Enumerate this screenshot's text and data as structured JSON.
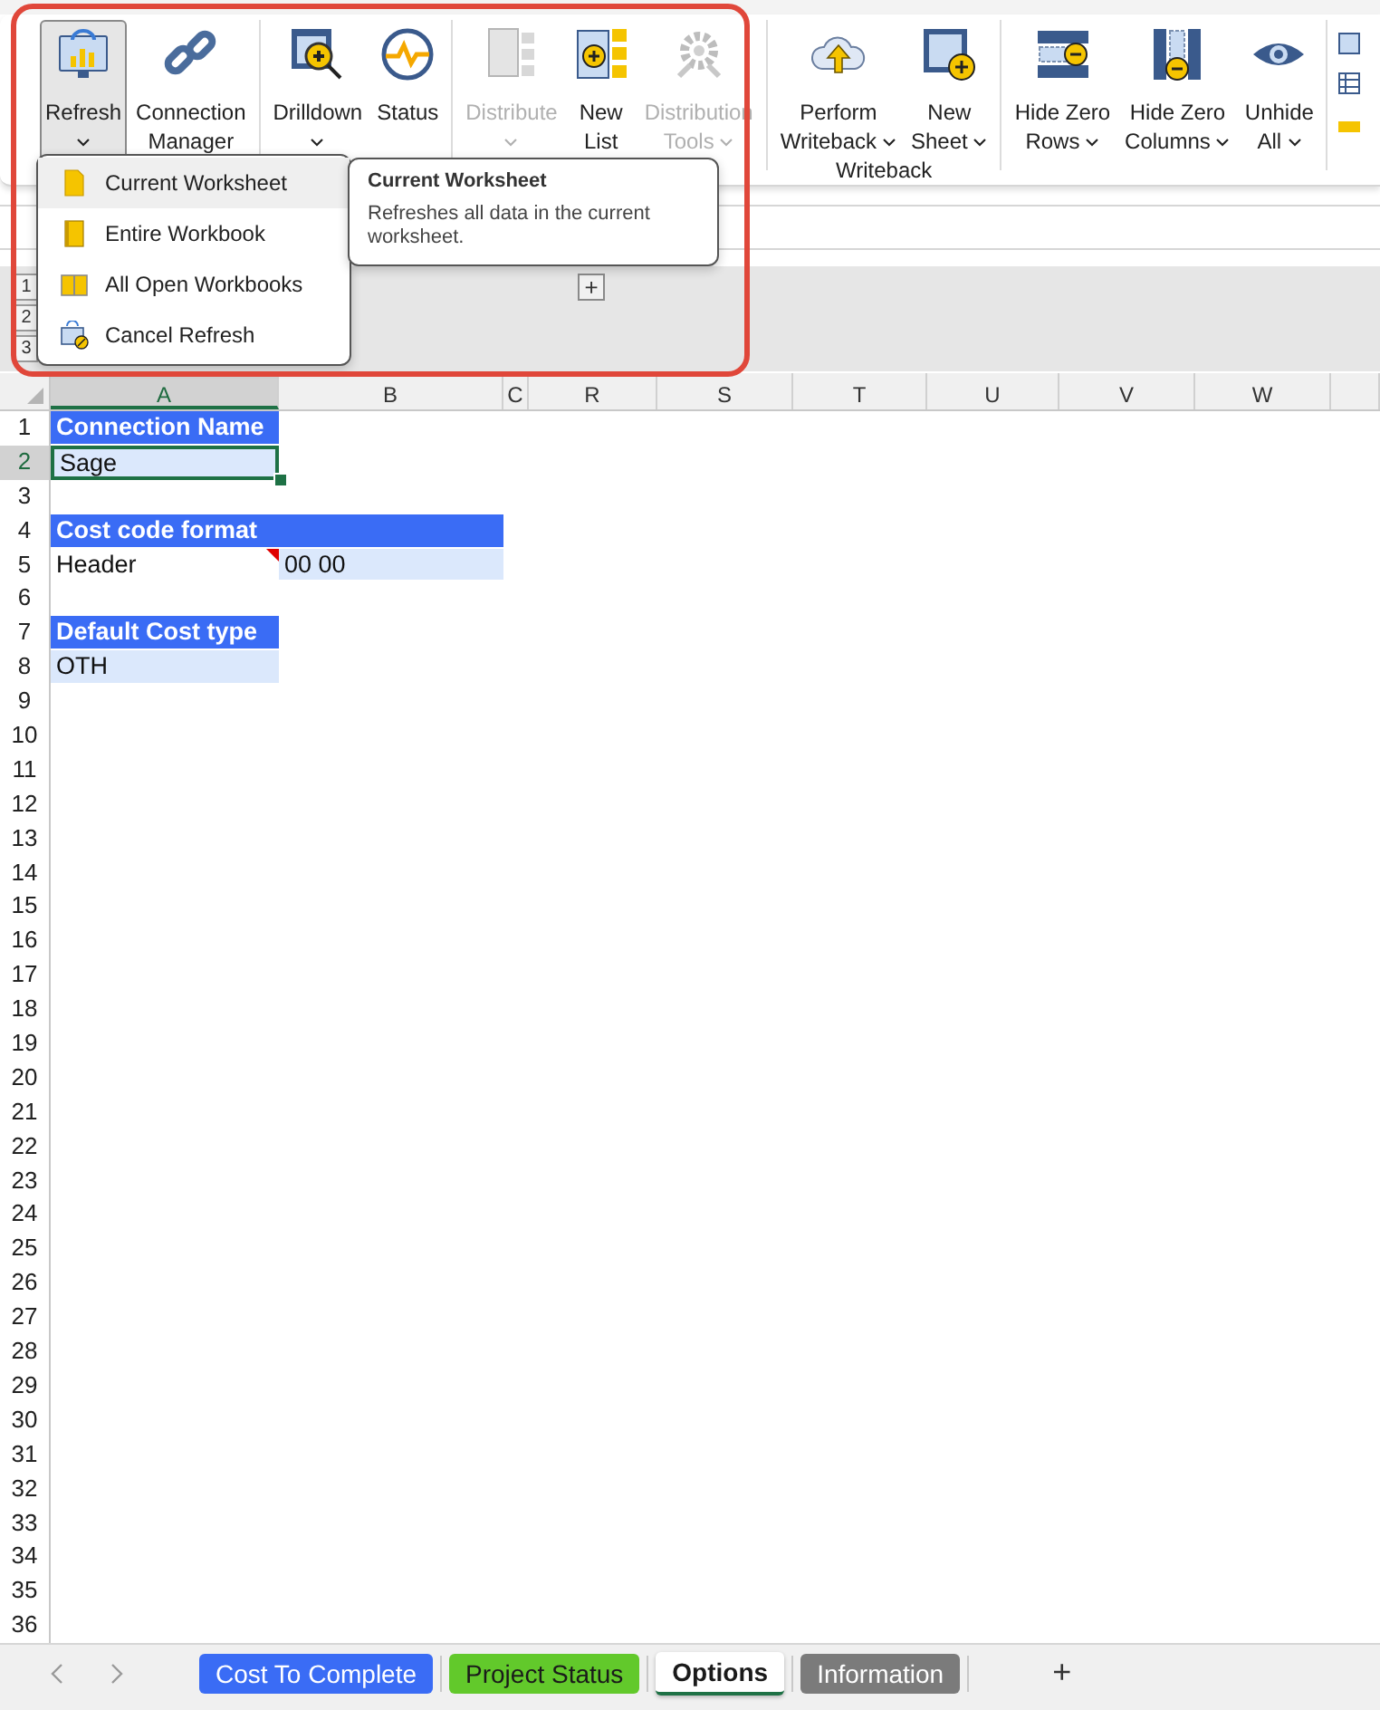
{
  "ribbon": {
    "groups": [
      {
        "buttons": [
          {
            "lines": [
              "Refresh"
            ],
            "dropdown": true,
            "selected": true,
            "disabled": false
          },
          {
            "lines": [
              "Connection",
              "Manager"
            ],
            "dropdown": false,
            "selected": false,
            "disabled": false
          }
        ]
      },
      {
        "buttons": [
          {
            "lines": [
              "Drilldown"
            ],
            "dropdown": true,
            "selected": false,
            "disabled": false
          },
          {
            "lines": [
              "Status"
            ],
            "dropdown": false,
            "selected": false,
            "disabled": false
          }
        ]
      },
      {
        "buttons": [
          {
            "lines": [
              "Distribute"
            ],
            "dropdown": true,
            "selected": false,
            "disabled": true
          },
          {
            "lines": [
              "New",
              "List"
            ],
            "dropdown": false,
            "selected": false,
            "disabled": false
          },
          {
            "lines": [
              "Distribution",
              "Tools"
            ],
            "dropdown": true,
            "selected": false,
            "disabled": true
          }
        ]
      },
      {
        "label": "Writeback",
        "buttons": [
          {
            "lines": [
              "Perform",
              "Writeback"
            ],
            "dropdown": true,
            "selected": false,
            "disabled": false
          },
          {
            "lines": [
              "New",
              "Sheet"
            ],
            "dropdown": true,
            "selected": false,
            "disabled": false
          }
        ]
      },
      {
        "buttons": [
          {
            "lines": [
              "Hide Zero",
              "Rows"
            ],
            "dropdown": true,
            "selected": false,
            "disabled": false
          },
          {
            "lines": [
              "Hide Zero",
              "Columns"
            ],
            "dropdown": true,
            "selected": false,
            "disabled": false
          },
          {
            "lines": [
              "Unhide",
              "All"
            ],
            "dropdown": true,
            "selected": false,
            "disabled": false
          }
        ]
      }
    ]
  },
  "refresh_menu": {
    "items": [
      {
        "label": "Current Worksheet",
        "selected": true
      },
      {
        "label": "Entire Workbook",
        "selected": false
      },
      {
        "label": "All Open Workbooks",
        "selected": false
      },
      {
        "label": "Cancel Refresh",
        "selected": false
      }
    ]
  },
  "tooltip": {
    "title": "Current Worksheet",
    "text": "Refreshes all data in the current worksheet."
  },
  "outline": {
    "levels": [
      "1",
      "2",
      "3"
    ],
    "expand_button": "+"
  },
  "sheet": {
    "columns": [
      {
        "label": "A",
        "selected": true
      },
      {
        "label": "B",
        "selected": false
      },
      {
        "label": "C",
        "selected": false
      },
      {
        "label": "R",
        "selected": false
      },
      {
        "label": "S",
        "selected": false
      },
      {
        "label": "T",
        "selected": false
      },
      {
        "label": "U",
        "selected": false
      },
      {
        "label": "V",
        "selected": false
      },
      {
        "label": "W",
        "selected": false
      }
    ],
    "rows": [
      {
        "number": "1",
        "selected": false,
        "a": {
          "text": "Connection Name",
          "kind": "header",
          "merged": false,
          "selected": false,
          "comment": false
        }
      },
      {
        "number": "2",
        "selected": true,
        "a": {
          "text": "Sage",
          "kind": "input",
          "merged": false,
          "selected": true,
          "comment": false
        }
      },
      {
        "number": "3",
        "selected": false
      },
      {
        "number": "4",
        "selected": false,
        "a": {
          "text": "Cost code format",
          "kind": "header",
          "merged": true,
          "selected": false,
          "comment": false
        }
      },
      {
        "number": "5",
        "selected": false,
        "a": {
          "text": "Header",
          "kind": "plain",
          "merged": false,
          "selected": false,
          "comment": true
        },
        "b": {
          "text": "00 00",
          "kind": "input",
          "merged": false,
          "selected": false,
          "comment": false
        }
      },
      {
        "number": "6",
        "selected": false
      },
      {
        "number": "7",
        "selected": false,
        "a": {
          "text": "Default Cost type",
          "kind": "header",
          "merged": false,
          "selected": false,
          "comment": false
        }
      },
      {
        "number": "8",
        "selected": false,
        "a": {
          "text": "OTH",
          "kind": "input",
          "merged": false,
          "selected": false,
          "comment": false
        }
      },
      {
        "number": "9",
        "selected": false
      },
      {
        "number": "10",
        "selected": false
      },
      {
        "number": "11",
        "selected": false
      },
      {
        "number": "12",
        "selected": false
      },
      {
        "number": "13",
        "selected": false
      },
      {
        "number": "14",
        "selected": false
      },
      {
        "number": "15",
        "selected": false
      },
      {
        "number": "16",
        "selected": false
      },
      {
        "number": "17",
        "selected": false
      },
      {
        "number": "18",
        "selected": false
      },
      {
        "number": "19",
        "selected": false
      },
      {
        "number": "20",
        "selected": false
      },
      {
        "number": "21",
        "selected": false
      },
      {
        "number": "22",
        "selected": false
      },
      {
        "number": "23",
        "selected": false
      },
      {
        "number": "24",
        "selected": false
      },
      {
        "number": "25",
        "selected": false
      },
      {
        "number": "26",
        "selected": false
      },
      {
        "number": "27",
        "selected": false
      },
      {
        "number": "28",
        "selected": false
      },
      {
        "number": "29",
        "selected": false
      },
      {
        "number": "30",
        "selected": false
      },
      {
        "number": "31",
        "selected": false
      },
      {
        "number": "32",
        "selected": false
      },
      {
        "number": "33",
        "selected": false
      },
      {
        "number": "34",
        "selected": false
      },
      {
        "number": "35",
        "selected": false
      },
      {
        "number": "36",
        "selected": false
      }
    ]
  },
  "sheet_tabs": [
    {
      "label": "Cost To Complete",
      "color": "#3a6cf5",
      "selected": false
    },
    {
      "label": "Project Status",
      "color": "#62c92b",
      "selected": false
    },
    {
      "label": "Options",
      "color": "#ffffff",
      "selected": true
    },
    {
      "label": "Information",
      "color": "#7b7b7b",
      "selected": false
    }
  ],
  "add_sheet": "+"
}
